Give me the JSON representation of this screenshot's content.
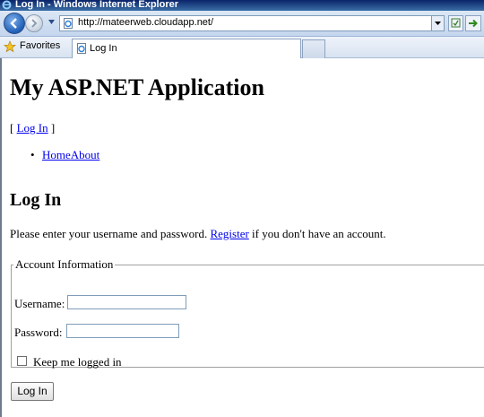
{
  "window": {
    "title": "Log In - Windows Internet Explorer",
    "icon": "ie-icon"
  },
  "navbar": {
    "url": "http://mateerweb.cloudapp.net/"
  },
  "favbar": {
    "favorites_label": "Favorites",
    "tab_title": "Log In"
  },
  "page": {
    "app_title": "My ASP.NET Application",
    "login_status": {
      "prefix": "[ ",
      "link": "Log In",
      "suffix": " ]"
    },
    "menu": {
      "bullet": "•",
      "home": "Home",
      "about": "About"
    },
    "login_title": "Log In",
    "intro": {
      "before": "Please enter your username and password. ",
      "register_link": "Register",
      "after": " if you don't have an account."
    },
    "fieldset": {
      "legend": "Account Information",
      "username_label": "Username:",
      "username_value": "",
      "password_label": "Password:",
      "password_value": "",
      "remember_label": "Keep me logged in",
      "remember_checked": false
    },
    "login_button": "Log In"
  },
  "colors": {
    "link": "#0000ee",
    "titlebar": "#0a246a"
  }
}
